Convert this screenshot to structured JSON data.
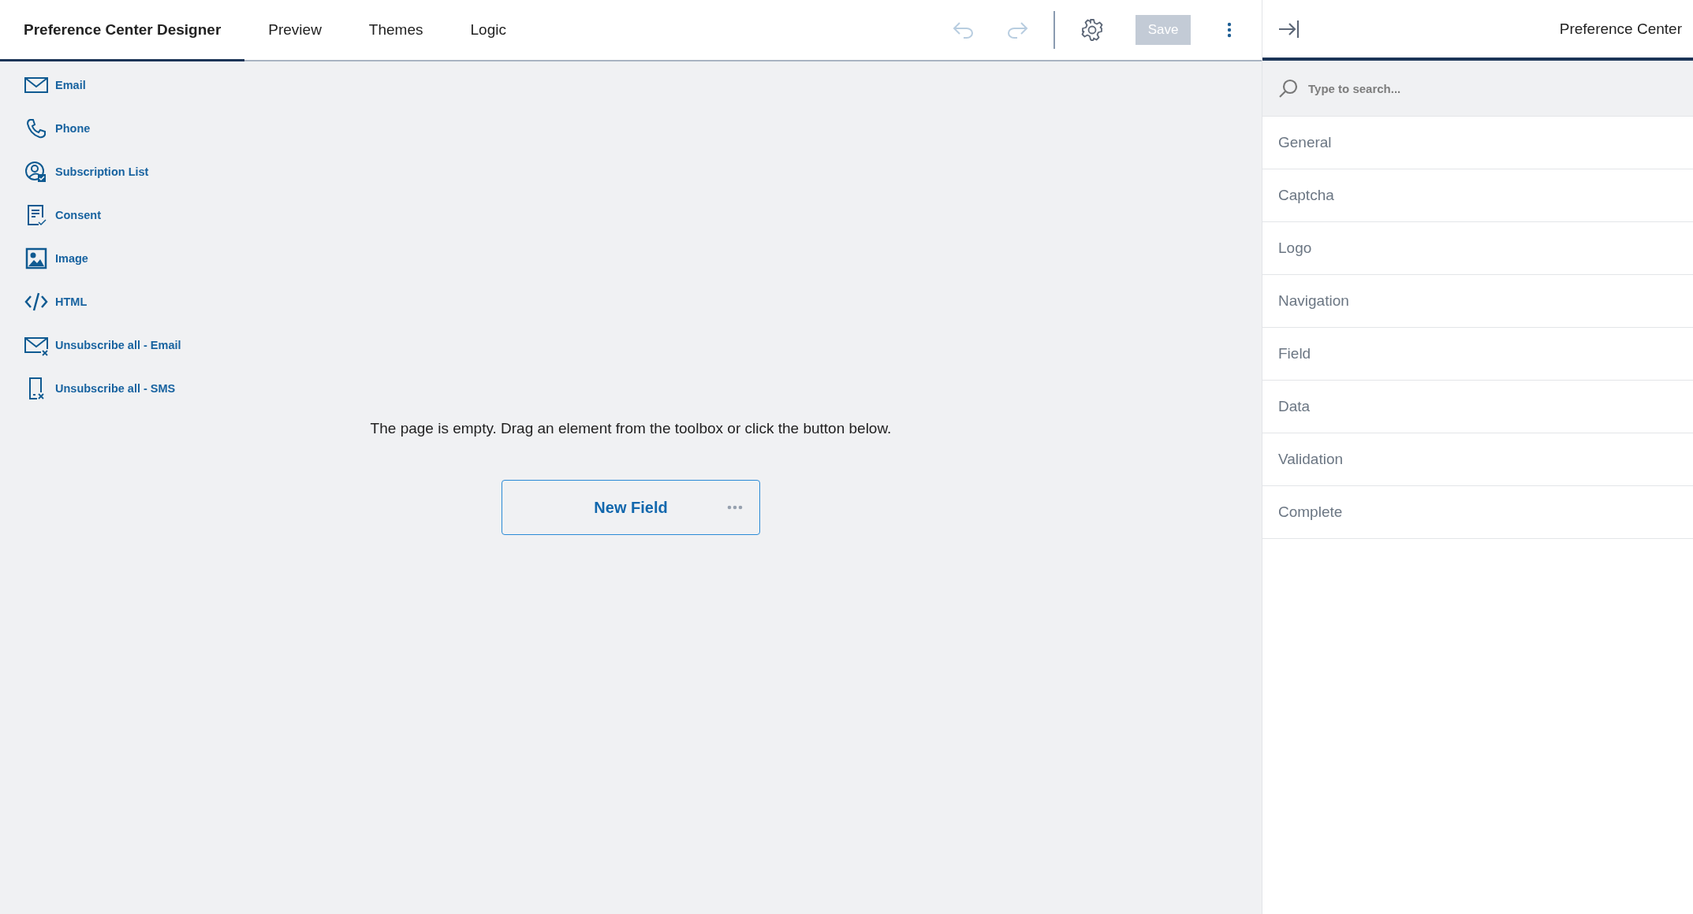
{
  "tabs": [
    {
      "label": "Preference Center Designer",
      "selected": true
    },
    {
      "label": "Preview",
      "selected": false
    },
    {
      "label": "Themes",
      "selected": false
    },
    {
      "label": "Logic",
      "selected": false
    }
  ],
  "toolbar": {
    "undo": {
      "disabled": true
    },
    "redo": {
      "disabled": true
    },
    "save": {
      "label": "Save",
      "disabled": true
    }
  },
  "toolbox": [
    {
      "kind": "email",
      "label": "Email"
    },
    {
      "kind": "phone",
      "label": "Phone"
    },
    {
      "kind": "subscription",
      "label": "Subscription List"
    },
    {
      "kind": "consent",
      "label": "Consent"
    },
    {
      "kind": "image",
      "label": "Image"
    },
    {
      "kind": "html",
      "label": "HTML"
    },
    {
      "kind": "unsub-email",
      "label": "Unsubscribe all - Email"
    },
    {
      "kind": "unsub-sms",
      "label": "Unsubscribe all - SMS"
    }
  ],
  "canvas": {
    "message": "The page is empty. Drag an element from the toolbox or click the button below.",
    "new_field_button": "New Field"
  },
  "panel": {
    "title": "Preference Center",
    "search": {
      "placeholder": "Type to search..."
    },
    "categories": [
      "General",
      "Captcha",
      "Logo",
      "Navigation",
      "Field",
      "Data",
      "Validation",
      "Complete"
    ]
  }
}
